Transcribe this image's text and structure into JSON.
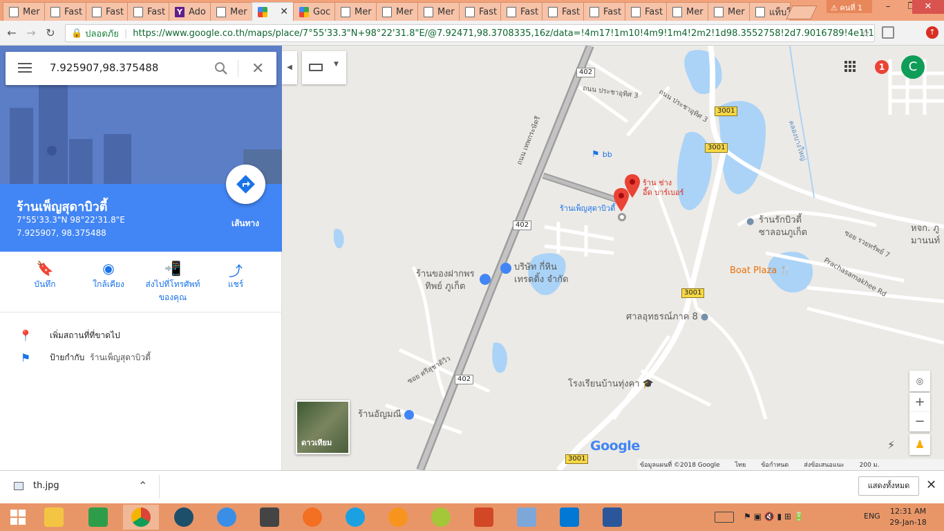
{
  "browser": {
    "tabs": [
      {
        "label": "Mer",
        "icon": "doc"
      },
      {
        "label": "Fast",
        "icon": "doc"
      },
      {
        "label": "Fast",
        "icon": "doc"
      },
      {
        "label": "Fast",
        "icon": "doc"
      },
      {
        "label": "Ado",
        "icon": "yahoo"
      },
      {
        "label": "Mer",
        "icon": "doc"
      },
      {
        "label": "",
        "icon": "maps",
        "active": true
      },
      {
        "label": "Goc",
        "icon": "maps"
      },
      {
        "label": "Mer",
        "icon": "doc"
      },
      {
        "label": "Mer",
        "icon": "doc"
      },
      {
        "label": "Mer",
        "icon": "doc"
      },
      {
        "label": "Fast",
        "icon": "doc"
      },
      {
        "label": "Fast",
        "icon": "doc"
      },
      {
        "label": "Fast",
        "icon": "doc"
      },
      {
        "label": "Fast",
        "icon": "doc"
      },
      {
        "label": "Fast",
        "icon": "doc"
      },
      {
        "label": "Mer",
        "icon": "doc"
      },
      {
        "label": "Mer",
        "icon": "doc"
      },
      {
        "label": "แท็บใหม่",
        "icon": "doc"
      }
    ],
    "profile_label": "คนที่ 1",
    "secure_label": "ปลอดภัย",
    "url": "https://www.google.co.th/maps/place/7°55'33.3\"N+98°22'31.8\"E/@7.92471,98.3708335,16z/data=!4m17!1m10!4m9!1m4!2m2!1d98.3552758!2d7.9016789!4e1!1m3!2m2..."
  },
  "search": {
    "query": "7.925907,98.375488"
  },
  "place": {
    "name": "ร้านเพ็ญสุดาบิวตี้",
    "dms": "7°55'33.3\"N 98°22'31.8\"E",
    "decimal": "7.925907, 98.375488",
    "directions_label": "เส้นทาง"
  },
  "actions": [
    {
      "label": "บันทึก",
      "icon": "bookmark-icon"
    },
    {
      "label": "ใกล้เคียง",
      "icon": "nearby-icon"
    },
    {
      "label": "ส่งไปที่โทรศัพท์ของคุณ",
      "icon": "send-to-phone-icon"
    },
    {
      "label": "แชร์",
      "icon": "share-icon"
    }
  ],
  "rows": {
    "add_missing": "เพิ่มสถานที่ที่ขาดไป",
    "label_prefix": "ป้ายกำกับ",
    "label_value": "ร้านเพ็ญสุดาบิวตี้"
  },
  "satellite_label": "ดาวเทียม",
  "map": {
    "roads": {
      "r402a": "402",
      "r402b": "402",
      "r402c": "402",
      "r3001a": "3001",
      "r3001b": "3001",
      "r3001c": "3001",
      "r3001d": "3001"
    },
    "streets": {
      "prachautid3a": "ถนน ประชาอุทิศ 3",
      "prachautid3b": "ถนน ประชาอุทิศ 3",
      "thepkrasattri": "ถนน เทพกระษัตรี",
      "khlong": "คลองบางใหญ่",
      "soi_raiphat": "ซอย รวยทรัพย์ 7",
      "prachasamakhee": "Prachasamakhee Rd",
      "soi_sri": "ซอย ศรีสุชาติวิว"
    },
    "pois": {
      "bb": "bb",
      "barber": "ร้าน ช่าง\nอี๊ด บาร์เบอร์",
      "pensuda": "ร้านเพ็ญสุดาบิวตี้",
      "rakbeauty": "ร้านรักบิวตี้\nซาลอนภูเก็ต",
      "hjk": "หจก. ภู\nมานนท์",
      "boat": "Boat Plaza",
      "kitchen": "ร้านของฝากพร\nทิพย์ ภูเก็ต",
      "trading": "บริษัท กี่หิน\nเทรดดิ้ง จำกัด",
      "shrine": "ศาลอุทธรณ์ภาค 8",
      "school": "โรงเรียนบ้านทุ่งคา",
      "anchamanee": "ร้านอัญมณี"
    },
    "footer": {
      "data": "ข้อมูลแผนที่ ©2018 Google",
      "lang": "ไทย",
      "terms": "ข้อกำหนด",
      "feedback": "ส่งข้อเสนอแนะ",
      "scale": "200 ม."
    },
    "google_logo": "Google",
    "notif_count": "1",
    "avatar_letter": "C"
  },
  "download": {
    "file": "th.jpg",
    "show_all": "แสดงทั้งหมด"
  },
  "taskbar": {
    "lang": "ENG",
    "time": "12:31 AM",
    "date": "29-Jan-18"
  },
  "colors": {
    "accent": "#4285f4",
    "pin": "#ea4335",
    "taskbar": "#e89668"
  }
}
